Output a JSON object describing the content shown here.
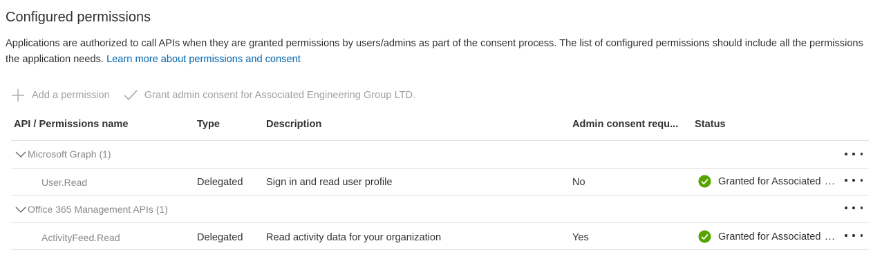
{
  "section": {
    "title": "Configured permissions",
    "description": "Applications are authorized to call APIs when they are granted permissions by users/admins as part of the consent process. The list of configured permissions should include all the permissions the application needs.",
    "link": "Learn more about permissions and consent"
  },
  "toolbar": {
    "add_label": "Add a permission",
    "grant_label": "Grant admin consent for Associated Engineering Group LTD."
  },
  "table": {
    "headers": [
      "API / Permissions name",
      "Type",
      "Description",
      "Admin consent requ...",
      "Status"
    ],
    "groups": [
      {
        "name": "Microsoft Graph (1)",
        "rows": [
          {
            "permission": "User.Read",
            "type": "Delegated",
            "description": "Sign in and read user profile",
            "admin_consent": "No",
            "status": "Granted for Associated",
            "status_truncated": "..."
          }
        ]
      },
      {
        "name": "Office 365 Management APIs (1)",
        "rows": [
          {
            "permission": "ActivityFeed.Read",
            "type": "Delegated",
            "description": "Read activity data for your organization",
            "admin_consent": "Yes",
            "status": "Granted for Associated",
            "status_truncated": "..."
          }
        ]
      }
    ]
  },
  "colors": {
    "link": "#0062ad",
    "granted_icon": "#57a300",
    "disabled_text": "#a19f9d"
  },
  "icons": [
    "add-icon",
    "checkmark-icon",
    "chevron-down-icon",
    "more-icon",
    "granted-check-icon"
  ]
}
